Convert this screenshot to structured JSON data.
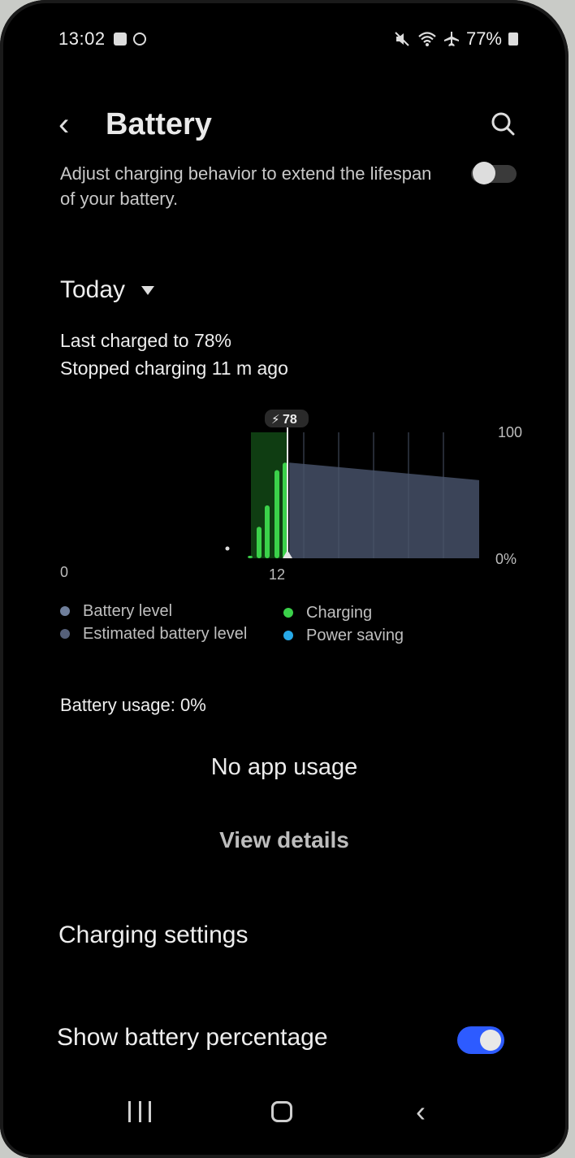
{
  "status_bar": {
    "time": "13:02",
    "battery_pct": "77%",
    "icons": [
      "checkbox-icon",
      "circle-icon",
      "mute-icon",
      "wifi-icon",
      "airplane-icon",
      "battery-icon"
    ]
  },
  "header": {
    "title": "Battery"
  },
  "adaptive": {
    "description": "Adjust charging behavior to extend the lifespan of your battery.",
    "toggle_on": false
  },
  "period": {
    "label": "Today"
  },
  "summary": {
    "line1": "Last charged to 78%",
    "line2": "Stopped charging 11 m ago"
  },
  "chart_data": {
    "type": "bar",
    "marker_label": "78",
    "y_top_label": "100",
    "y_bottom_label": "0%",
    "x_labels": [
      "0",
      "12"
    ],
    "charging_bars": [
      2,
      25,
      42,
      70,
      76
    ],
    "estimated_level": {
      "start": 76,
      "end": 62
    },
    "colors": {
      "charging": "#3bd14a",
      "charging_bg": "#0f3d12",
      "estimated": "#3b4458",
      "marker": "#e6e6e6"
    }
  },
  "legend": {
    "left": [
      {
        "label": "Battery level",
        "color": "#6f7f9b"
      },
      {
        "label": "Estimated battery level",
        "color": "#55607a"
      }
    ],
    "right": [
      {
        "label": "Charging",
        "color": "#3bd14a"
      },
      {
        "label": "Power saving",
        "color": "#27a9e8"
      }
    ]
  },
  "usage": {
    "label": "Battery usage: 0%",
    "empty": "No app usage",
    "details": "View details"
  },
  "settings": {
    "charging": "Charging settings",
    "show_pct": "Show battery percentage",
    "show_pct_on": true
  }
}
